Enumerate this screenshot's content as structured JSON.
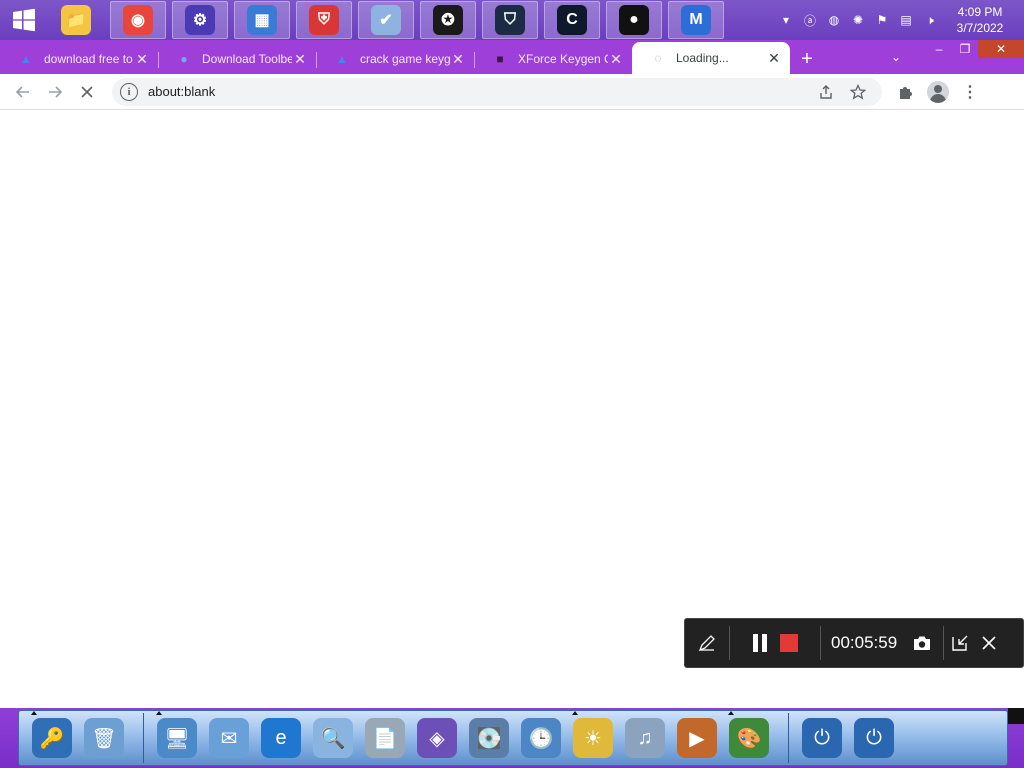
{
  "taskbar": {
    "start_icon": "windows-logo-icon",
    "pinned": [
      {
        "name": "file-explorer-icon",
        "glyph": "📁",
        "bg": "#f4c542",
        "active": false
      },
      {
        "name": "chrome-icon",
        "glyph": "◉",
        "bg": "#e8453c",
        "active": true
      },
      {
        "name": "settings-icon",
        "glyph": "⚙",
        "bg": "#4a3bb5",
        "active": true
      },
      {
        "name": "control-panel-icon",
        "glyph": "▦",
        "bg": "#3a7bd5",
        "active": true
      },
      {
        "name": "red-shield-icon",
        "glyph": "⛨",
        "bg": "#d93636",
        "active": true
      },
      {
        "name": "blue-shield-icon",
        "glyph": "✔",
        "bg": "#8fb3e0",
        "active": true
      },
      {
        "name": "red-gear-icon",
        "glyph": "✪",
        "bg": "#1a1a1a",
        "active": true
      },
      {
        "name": "vpn-shield-icon",
        "glyph": "⛉",
        "bg": "#1b2b45",
        "active": true
      },
      {
        "name": "ccleaner-icon",
        "glyph": "C",
        "bg": "#0e1a2b",
        "active": true
      },
      {
        "name": "screen-recorder-icon",
        "glyph": "●",
        "bg": "#111111",
        "active": true
      },
      {
        "name": "malwarebytes-icon",
        "glyph": "M",
        "bg": "#2c6ed5",
        "active": true
      }
    ],
    "tray": [
      {
        "name": "chevron-up-icon",
        "glyph": "▾"
      },
      {
        "name": "avira-icon",
        "glyph": "ⓐ"
      },
      {
        "name": "recorder-tray-icon",
        "glyph": "◍"
      },
      {
        "name": "red-circle-icon",
        "glyph": "✺"
      },
      {
        "name": "flag-icon",
        "glyph": "⚑"
      },
      {
        "name": "network-icon",
        "glyph": "▤"
      },
      {
        "name": "volume-muted-icon",
        "glyph": "🕨"
      }
    ],
    "time": "4:09 PM",
    "date": "3/7/2022"
  },
  "tabs": [
    {
      "label": "download free to",
      "favicon": "▲",
      "favicon_color": "#4285f4",
      "active": false
    },
    {
      "label": "Download Toolbe",
      "favicon": "●",
      "favicon_color": "#7aa7f0",
      "active": false
    },
    {
      "label": "crack game keyge",
      "favicon": "▲",
      "favicon_color": "#4285f4",
      "active": false
    },
    {
      "label": "XForce Keygen C",
      "favicon": "■",
      "favicon_color": "#3b1a4a",
      "active": false
    },
    {
      "label": "Loading...",
      "favicon": "◌",
      "favicon_color": "#9aa0a6",
      "active": true
    }
  ],
  "toolbar": {
    "back_icon": "arrow-left-icon",
    "forward_icon": "arrow-right-icon",
    "stop_icon": "close-icon",
    "url": "about:blank"
  },
  "recorder": {
    "elapsed": "00:05:59"
  },
  "dock": {
    "items": [
      {
        "name": "key-icon",
        "glyph": "🔑",
        "bg": "#2f6fb8",
        "running": true
      },
      {
        "name": "trash-icon",
        "glyph": "🗑",
        "bg": "#6e9fd3",
        "running": false
      },
      {
        "name": "network-computer-icon",
        "glyph": "🖥",
        "bg": "#4b8ac9",
        "running": true
      },
      {
        "name": "mail-icon",
        "glyph": "✉",
        "bg": "#6aa0d8",
        "running": false
      },
      {
        "name": "internet-explorer-icon",
        "glyph": "e",
        "bg": "#1f77d0",
        "running": false
      },
      {
        "name": "magnifier-icon",
        "glyph": "🔍",
        "bg": "#8ab4e0",
        "running": false
      },
      {
        "name": "rtf-document-icon",
        "glyph": "📄",
        "bg": "#9aa7b5",
        "running": false
      },
      {
        "name": "cube-icon",
        "glyph": "◈",
        "bg": "#6d4fb8",
        "running": false
      },
      {
        "name": "disk-drive-icon",
        "glyph": "💽",
        "bg": "#5b7ea8",
        "running": false
      },
      {
        "name": "folder-clock-icon",
        "glyph": "🕒",
        "bg": "#4d86c4",
        "running": false
      },
      {
        "name": "photo-icon",
        "glyph": "☀",
        "bg": "#e0b93a",
        "running": true
      },
      {
        "name": "music-icon",
        "glyph": "♫",
        "bg": "#8ca3bf",
        "running": false
      },
      {
        "name": "video-icon",
        "glyph": "▶",
        "bg": "#c2682b",
        "running": false
      },
      {
        "name": "paint-icon",
        "glyph": "🎨",
        "bg": "#3f8a3a",
        "running": true
      },
      {
        "name": "logoff-icon",
        "glyph": "⏻",
        "bg": "#2a67b0",
        "running": false
      },
      {
        "name": "power-icon",
        "glyph": "⏻",
        "bg": "#2a67b0",
        "running": false
      }
    ]
  }
}
